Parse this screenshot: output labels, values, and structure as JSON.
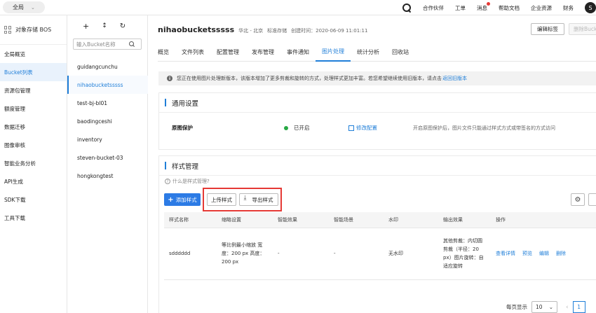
{
  "topbar": {
    "region": "全局",
    "nav": [
      "合作伙伴",
      "工单",
      "消息",
      "帮助文档",
      "企业资源",
      "财务"
    ],
    "avatar_letter": "S"
  },
  "sidebar": {
    "title": "对象存储 BOS",
    "items": [
      "全局概览",
      "Bucket列表",
      "资源包管理",
      "额度管理",
      "数据迁移",
      "图像审核",
      "智能业务分析",
      "API生成",
      "SDK下载",
      "工具下载"
    ]
  },
  "buckets": {
    "search_placeholder": "输入Bucket名称",
    "items": [
      "guidangcunchu",
      "nihaobucketsssss",
      "test-bj-bl01",
      "baodingceshi",
      "inventory",
      "steven-bucket-03",
      "hongkongtest"
    ]
  },
  "header": {
    "bucket_name": "nihaobucketsssss",
    "region": "华北 - 北京",
    "storage_class": "标准存储",
    "created": "创建时间：2020-06-09 11:01:11",
    "edit_tag": "编辑标签",
    "delete_bucket": "删除Buck"
  },
  "tabs": [
    "概览",
    "文件列表",
    "配置管理",
    "发布管理",
    "事件通知",
    "图片处理",
    "统计分析",
    "回收站"
  ],
  "notice": {
    "text": "您正在使用图片处理新版本，该版本增加了更多剪裁和旋转的方式，处理样式更加丰富。若您希望继续使用旧版本，请点击",
    "link": "返回旧版本"
  },
  "general": {
    "title": "通用设置",
    "label": "原图保护",
    "status": "已开启",
    "edit": "修改配置",
    "desc": "开启原图保护后，图片文件只能通过样式方式或带签名的方式访问"
  },
  "styles": {
    "title": "样式管理",
    "help": "什么是样式管理?",
    "add": "添加样式",
    "upload": "上传样式",
    "export": "导出样式",
    "columns": [
      "样式名称",
      "缩略设置",
      "智能效果",
      "智能场景",
      "水印",
      "输出效果",
      "操作"
    ],
    "row": {
      "name": "sdddddd",
      "thumb": "等比例最小缩放 宽度：200 px 高度：200 px",
      "effect": "-",
      "scene": "-",
      "watermark": "无水印",
      "output": "其他剪裁：内切圆剪裁（半径：20 px）图片旋转：自适应旋转",
      "ops": [
        "查看详情",
        "预览",
        "编辑",
        "删除"
      ]
    },
    "pager": {
      "label": "每页显示",
      "size": "10",
      "page": "1"
    }
  }
}
